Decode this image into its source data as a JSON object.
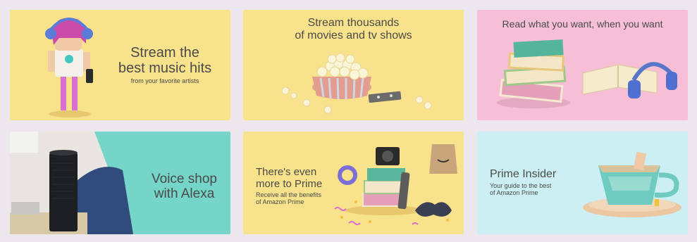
{
  "tiles": {
    "music": {
      "title_lines": [
        "Stream the",
        "best music hits"
      ],
      "subtitle": "from your favorite artists"
    },
    "movies": {
      "title_lines": [
        "Stream thousands",
        "of movies and tv shows"
      ]
    },
    "reading": {
      "title": "Read what you want, when you want"
    },
    "alexa": {
      "title_lines": [
        "Voice shop",
        "with Alexa"
      ]
    },
    "prime": {
      "title_lines": [
        "There's even",
        "more to Prime"
      ],
      "subtitle_lines": [
        "Receive all the benefits",
        "of Amazon Prime"
      ]
    },
    "insider": {
      "title": "Prime Insider",
      "subtitle_lines": [
        "Your guide to the best",
        "of Amazon Prime"
      ]
    }
  },
  "colors": {
    "yellow": "#f9e28c",
    "pink": "#f6bfd5",
    "teal": "#75d5c8",
    "light_blue": "#cbeff2",
    "text": "#4a4a4a"
  }
}
